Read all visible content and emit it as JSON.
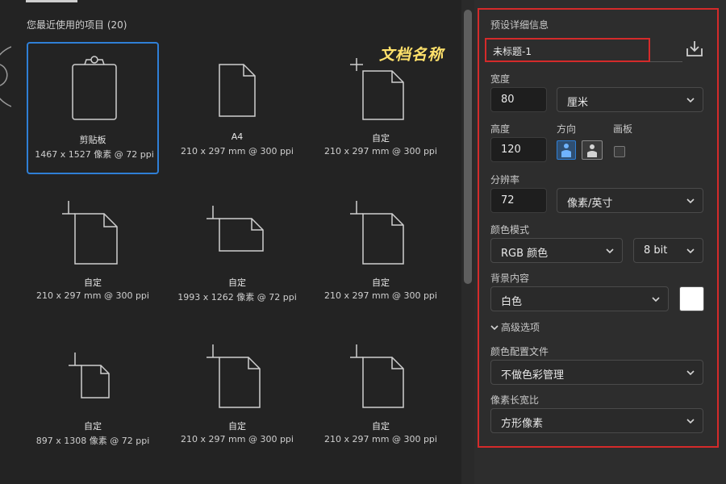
{
  "recent": {
    "title": "您最近使用的项目 (20)",
    "items": [
      {
        "name": "剪贴板",
        "size": "1467 x 1527 像素 @ 72 ppi",
        "icon": "clipboard-icon"
      },
      {
        "name": "A4",
        "size": "210 x 297 mm @ 300 ppi",
        "icon": "document-icon"
      },
      {
        "name": "自定",
        "size": "210 x 297 mm @ 300 ppi",
        "icon": "custom-document-icon"
      },
      {
        "name": "自定",
        "size": "210 x 297 mm @ 300 ppi",
        "icon": "custom-document-icon"
      },
      {
        "name": "自定",
        "size": "1993 x 1262 像素 @ 72 ppi",
        "icon": "custom-landscape-document-icon"
      },
      {
        "name": "自定",
        "size": "210 x 297 mm @ 300 ppi",
        "icon": "custom-document-icon"
      },
      {
        "name": "自定",
        "size": "897 x 1308 像素 @ 72 ppi",
        "icon": "custom-document-icon"
      },
      {
        "name": "自定",
        "size": "210 x 297 mm @ 300 ppi",
        "icon": "custom-document-icon"
      },
      {
        "name": "自定",
        "size": "210 x 297 mm @ 300 ppi",
        "icon": "custom-document-icon"
      }
    ]
  },
  "annotation": "文档名称",
  "preset": {
    "title": "预设详细信息",
    "doc_name": "未标题-1",
    "save_icon": "save-preset-icon",
    "width_label": "宽度",
    "width_value": "80",
    "width_unit": "厘米",
    "height_label": "高度",
    "height_value": "120",
    "orientation_label": "方向",
    "artboard_label": "画板",
    "resolution_label": "分辨率",
    "resolution_value": "72",
    "resolution_unit": "像素/英寸",
    "color_mode_label": "颜色模式",
    "color_mode": "RGB 颜色",
    "bit_depth": "8 bit",
    "background_label": "背景内容",
    "background_value": "白色",
    "background_color": "#ffffff",
    "advanced_label": "高级选项",
    "color_profile_label": "颜色配置文件",
    "color_profile": "不做色彩管理",
    "pixel_aspect_label": "像素长宽比",
    "pixel_aspect": "方形像素"
  },
  "colors": {
    "accent": "#2f7fd6",
    "highlight": "#d42a2a",
    "annotation": "#ffe16b"
  }
}
